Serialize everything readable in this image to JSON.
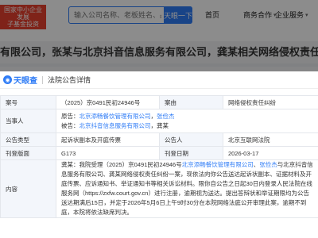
{
  "header": {
    "badge_line1": "国家中小企业发展",
    "badge_line2": "子基金投资",
    "search_placeholder": "输入公司名称、老板姓名、品牌名称等",
    "search_button": "天眼一下",
    "nav": [
      {
        "label": "首页"
      },
      {
        "label": "商务合作"
      },
      {
        "label": "企业服务"
      }
    ]
  },
  "page": {
    "title": "有限公司，张某与北京抖音信息服务有限公司，龚某相关网络侵权责任纠纷"
  },
  "modal": {
    "logo_text": "天眼查",
    "title": "法院公告详情",
    "fields": {
      "case_no_label": "案号",
      "case_no": "（2025）京0491民初24946号",
      "cause_label": "案由",
      "cause": "网络侵权责任纠纷",
      "parties_label": "当事人",
      "plaintiff_prefix": "原告：",
      "plaintiff_1": "北京添畅餐饮管理有限公司",
      "plaintiff_sep": "，",
      "plaintiff_2": "张俭杰",
      "defendant_prefix": "被告：",
      "defendant_1": "北京抖音信息服务有限公司",
      "defendant_rest": "，龚某",
      "notice_type_label": "公告类型",
      "notice_type": "起诉状副本及开庭传票",
      "notifier_label": "公告人",
      "notifier": "北京互联网法院",
      "layout_label": "刊登版面",
      "layout": "G173",
      "publish_date_label": "刊登日期",
      "publish_date": "2026-03-17",
      "content_label": "内容",
      "content_prefix": "龚某：我院受理（2025）京0491民初24946号",
      "content_link_1": "北京添畅餐饮管理有限公司",
      "content_sep": "、",
      "content_link_2": "张俭杰",
      "content_mid": "与北京抖音信息服务有限公",
      "content_rest": "司、龚某网络侵权责任纠纷一案，现依法向你公告送达起诉状副本、证据材料及开庭传票、应诉通知书、举证通知书等相关诉讼材料。限你自公告之日起30日内登录人民法院在线服务网（https://zxfw.court.gov.cn）进行注册，逾期视为送达。提出答辩状和举证期限均为公告送达期满后15日，并定于2026年5月6日上午9时30分在本院网络法庭公开审理此案，逾期不到庭，本院将依法缺席判决。"
    }
  }
}
